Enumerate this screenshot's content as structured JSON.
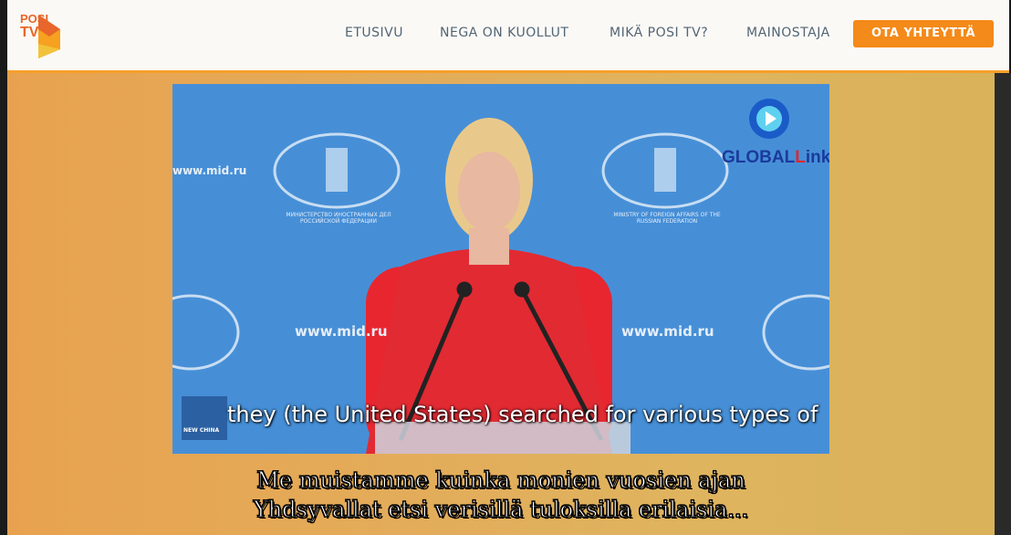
{
  "header": {
    "logo_text": [
      "POSI",
      "TV"
    ],
    "nav": [
      "ETUSIVU",
      "NEGA ON KUOLLUT",
      "MIKÄ POSI TV?",
      "MAINOSTAJA"
    ],
    "cta_label": "OTA YHTEYTTÄ"
  },
  "video": {
    "caption": "they (the United States) searched for various types of",
    "overlay_brand_a": "GLOBAL",
    "overlay_brand_b": "ink",
    "overlay_brand_l": "L",
    "channel_logo": "NEW CHINA",
    "backdrop_url": "www.mid.ru",
    "backdrop_ministry_ru": "МИНИСТЕРСТВО ИНОСТРАННЫХ ДЕЛ РОССИЙСКОЙ ФЕДЕРАЦИИ",
    "backdrop_ministry_en": "MINISTRY OF FOREIGN AFFAIRS OF THE RUSSIAN FEDERATION"
  },
  "subtitles": {
    "line1": "Me muistamme kuinka monien vuosien ajan",
    "line2": "Yhdsyvallat etsi verisillä tuloksilla erilaisia..."
  },
  "colors": {
    "accent": "#f48a19",
    "nav_text": "#526575",
    "video_bg": "#3f8ad4",
    "jacket": "#e8262f"
  }
}
